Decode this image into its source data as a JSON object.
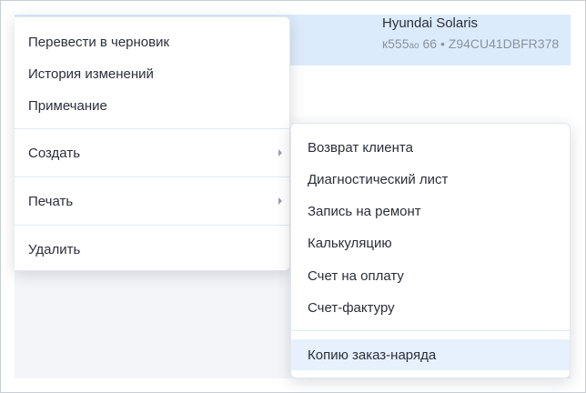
{
  "car": {
    "title": "Hyundai Solaris",
    "plate_prefix": "к555",
    "plate_series": "ао",
    "plate_region": "66",
    "separator": "•",
    "vin": "Z94CU41DBFR378"
  },
  "context_menu": {
    "items": [
      {
        "label": "Перевести в черновик"
      },
      {
        "label": "История изменений"
      },
      {
        "label": "Примечание"
      },
      {
        "label": "Создать"
      },
      {
        "label": "Печать"
      },
      {
        "label": "Удалить"
      }
    ]
  },
  "create_submenu": {
    "items": [
      {
        "label": "Возврат клиента"
      },
      {
        "label": "Диагностический лист"
      },
      {
        "label": "Запись на ремонт"
      },
      {
        "label": "Калькуляцию"
      },
      {
        "label": "Счет на оплату"
      },
      {
        "label": "Счет-фактуру"
      },
      {
        "label": "Копию заказ-наряда"
      }
    ],
    "hovered": "Копию заказ-наряда"
  }
}
